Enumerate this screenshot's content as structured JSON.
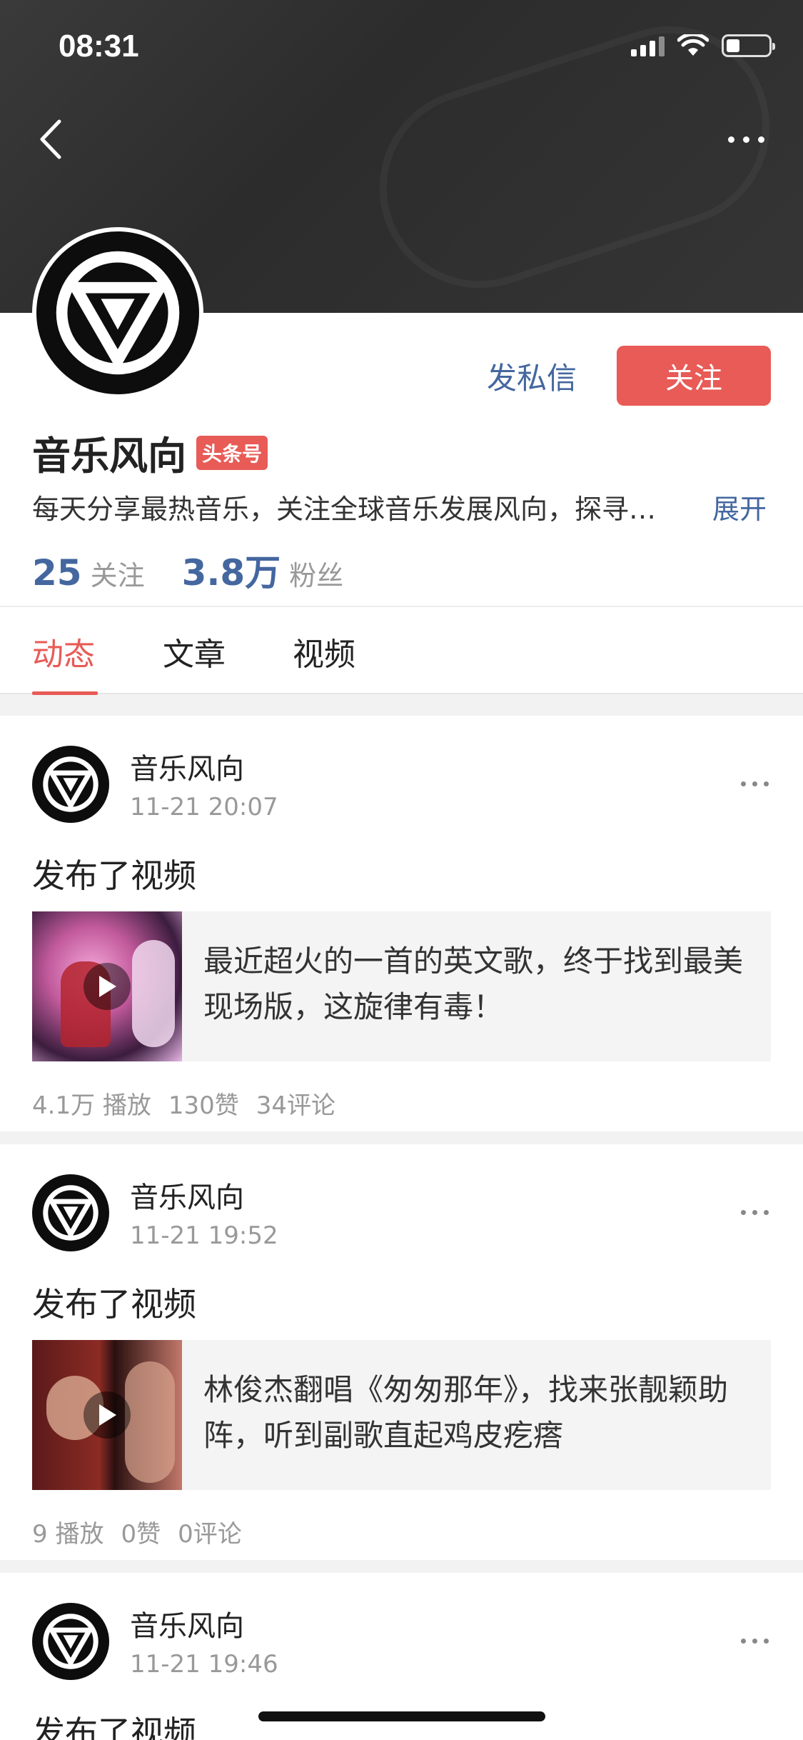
{
  "status_bar": {
    "time": "08:31"
  },
  "profile": {
    "name": "音乐风向",
    "badge": "头条号",
    "description": "每天分享最热音乐，关注全球音乐发展风向，探寻…",
    "expand_label": "展开",
    "message_label": "发私信",
    "follow_label": "关注",
    "following_count": "25",
    "following_label": "关注",
    "fans_count": "3.8万",
    "fans_label": "粉丝"
  },
  "tabs": [
    {
      "label": "动态",
      "active": true
    },
    {
      "label": "文章",
      "active": false
    },
    {
      "label": "视频",
      "active": false
    }
  ],
  "feed": [
    {
      "author": "音乐风向",
      "time": "11-21 20:07",
      "action": "发布了视频",
      "title": "最近超火的一首的英文歌，终于找到最美现场版，这旋律有毒！",
      "plays": "4.1万 播放",
      "likes": "130赞",
      "comments": "34评论"
    },
    {
      "author": "音乐风向",
      "time": "11-21 19:52",
      "action": "发布了视频",
      "title": "林俊杰翻唱《匆匆那年》，找来张靓颖助阵，听到副歌直起鸡皮疙瘩",
      "plays": "9 播放",
      "likes": "0赞",
      "comments": "0评论"
    },
    {
      "author": "音乐风向",
      "time": "11-21 19:46",
      "action": "发布了视频"
    }
  ],
  "colors": {
    "accent_red": "#e85b56",
    "link_blue": "#44679f",
    "banner": "#2f2f2f"
  }
}
